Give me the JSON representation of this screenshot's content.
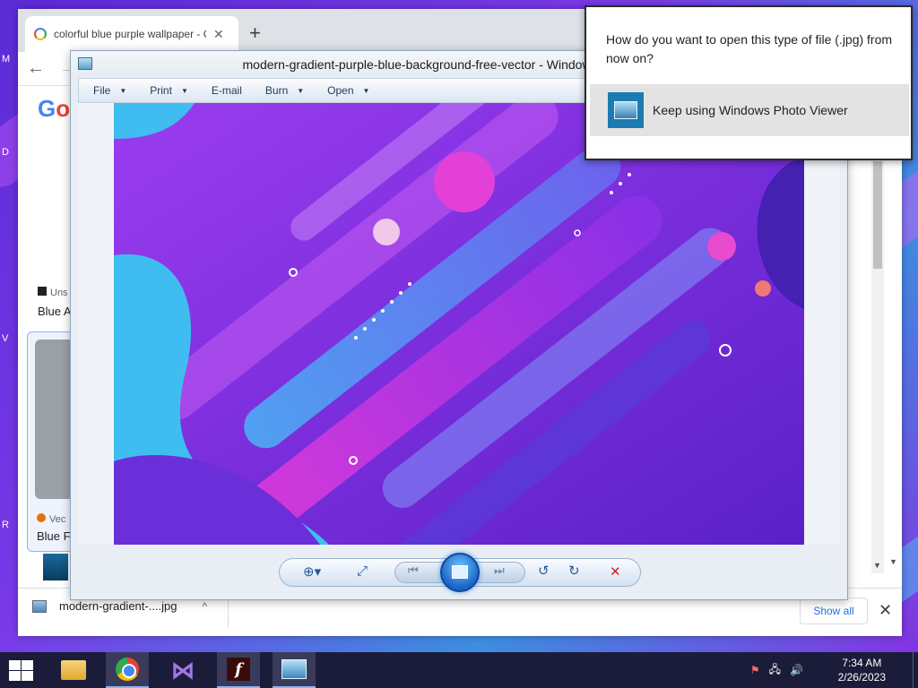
{
  "desktop": {
    "edge_letters": [
      "M",
      "D",
      "V",
      "R"
    ]
  },
  "chrome": {
    "tab_title": "colorful blue purple wallpaper - Google Search",
    "tab_close": "✕",
    "new_tab": "+",
    "back": "←",
    "forward": "→",
    "logo_g": "G",
    "logo_o": "o",
    "result1_source": "Uns",
    "result1_title": "Blue A",
    "result2_source": "Vec",
    "result2_title": "Blue F",
    "scroll_up": "▲",
    "scroll_down": "▼"
  },
  "downloads": {
    "file_name": "modern-gradient-....jpg",
    "chevron": "^",
    "show_all": "Show all",
    "close": "✕"
  },
  "viewer": {
    "title": "modern-gradient-purple-blue-background-free-vector - Windows Photo Viewer",
    "menu": [
      {
        "label": "File",
        "has_caret": true
      },
      {
        "label": "Print",
        "has_caret": true
      },
      {
        "label": "E-mail",
        "has_caret": false
      },
      {
        "label": "Burn",
        "has_caret": true
      },
      {
        "label": "Open",
        "has_caret": true
      }
    ],
    "caret": "▼",
    "controls": {
      "zoom": "⊕▾",
      "actual_size": "⤢",
      "previous": "⏮",
      "next": "⏭",
      "rotate_ccw": "↺",
      "rotate_cw": "↻",
      "delete": "✕"
    }
  },
  "dialog": {
    "question": "How do you want to open this type of file (.jpg) from now on?",
    "option_label": "Keep using Windows Photo Viewer"
  },
  "taskbar": {
    "time": "7:34 AM",
    "date": "2/26/2023",
    "flash_letter": "f",
    "vs_letter": "⋈",
    "tray_icons": [
      "flag-icon",
      "network-icon",
      "volume-icon"
    ],
    "tray_glyphs": [
      "⚑",
      "🖧",
      "🔊"
    ]
  },
  "colors": {
    "accent_blue": "#1a73e8",
    "taskbar_bg": "#1b1c39",
    "viewer_frame": "#e9eef5"
  }
}
